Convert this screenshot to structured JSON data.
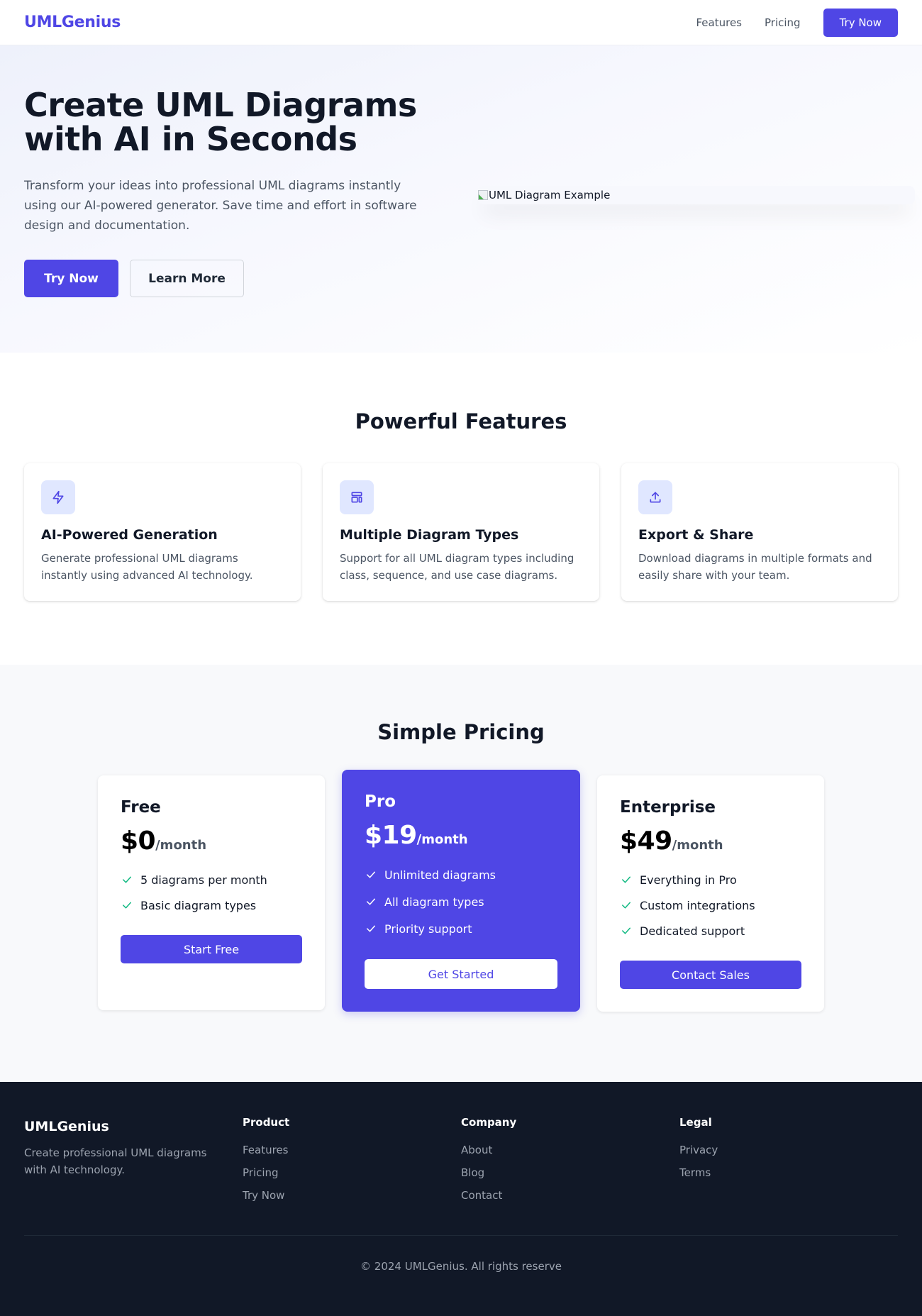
{
  "nav": {
    "logo": "UMLGenius",
    "links": [
      {
        "label": "Features"
      },
      {
        "label": "Pricing"
      }
    ],
    "cta_label": "Try Now"
  },
  "hero": {
    "title_line1": "Create UML Diagrams",
    "title_line2": "with AI in Seconds",
    "subtitle": "Transform your ideas into professional UML diagrams instantly using our AI-powered generator. Save time and effort in software design and documentation.",
    "primary_button": "Try Now",
    "secondary_button": "Learn More",
    "image_alt": "UML Diagram Example"
  },
  "features": {
    "title": "Powerful Features",
    "items": [
      {
        "icon": "lightning-icon",
        "title": "AI-Powered Generation",
        "description": "Generate professional UML diagrams instantly using advanced AI technology."
      },
      {
        "icon": "layout-icon",
        "title": "Multiple Diagram Types",
        "description": "Support for all UML diagram types including class, sequence, and use case diagrams."
      },
      {
        "icon": "upload-icon",
        "title": "Export & Share",
        "description": "Download diagrams in multiple formats and easily share with your team."
      }
    ]
  },
  "pricing": {
    "title": "Simple Pricing",
    "plans": [
      {
        "name": "Free",
        "price": "$0",
        "period": "/month",
        "features": [
          "5 diagrams per month",
          "Basic diagram types"
        ],
        "button": "Start Free",
        "highlighted": false
      },
      {
        "name": "Pro",
        "price": "$19",
        "period": "/month",
        "features": [
          "Unlimited diagrams",
          "All diagram types",
          "Priority support"
        ],
        "button": "Get Started",
        "highlighted": true
      },
      {
        "name": "Enterprise",
        "price": "$49",
        "period": "/month",
        "features": [
          "Everything in Pro",
          "Custom integrations",
          "Dedicated support"
        ],
        "button": "Contact Sales",
        "highlighted": false
      }
    ]
  },
  "footer": {
    "brand": "UMLGenius",
    "tagline": "Create professional UML diagrams with AI technology.",
    "columns": [
      {
        "heading": "Product",
        "links": [
          "Features",
          "Pricing",
          "Try Now"
        ]
      },
      {
        "heading": "Company",
        "links": [
          "About",
          "Blog",
          "Contact"
        ]
      },
      {
        "heading": "Legal",
        "links": [
          "Privacy",
          "Terms"
        ]
      }
    ],
    "copyright": "© 2024 UMLGenius. All rights reserve"
  },
  "colors": {
    "accent": "#4f46e5",
    "accent_light": "#e0e7ff",
    "check_green": "#10b981",
    "footer_bg": "#111827",
    "pricing_bg": "#f8f9fb"
  }
}
